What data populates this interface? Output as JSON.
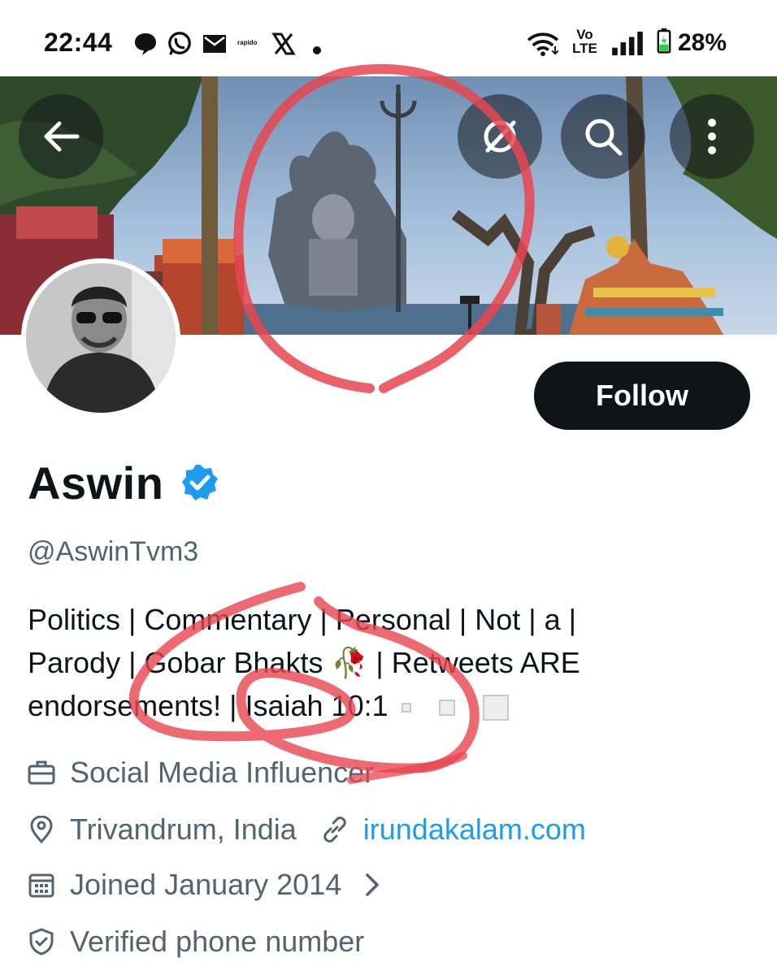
{
  "status_bar": {
    "time": "22:44",
    "icons": [
      "chat-bubble-icon",
      "whatsapp-icon",
      "mail-icon",
      "rapido-icon",
      "x-logo-icon",
      "dot-icon"
    ],
    "rapido_label": "rapido",
    "network_label_top": "Vo",
    "network_label_bottom": "LTE",
    "battery": "28%"
  },
  "banner": {
    "buttons": [
      "back-arrow-icon",
      "grok-icon",
      "search-icon",
      "more-vertical-icon"
    ]
  },
  "profile": {
    "display_name": "Aswin",
    "handle": "@AswinTvm3",
    "follow_label": "Follow",
    "bio_lines": [
      "Politics | Commentary | Personal | Not | a |",
      "Parody | Gobar Bhakts 🥀 | Retweets ARE",
      "endorsements! | Isaiah 10:1"
    ],
    "profession": "Social Media Influencer",
    "location": "Trivandrum, India",
    "website": "irundakalam.com",
    "joined": "Joined January 2014",
    "verified_phone": "Verified phone number"
  },
  "colors": {
    "text_primary": "#0f1419",
    "text_secondary": "#536471",
    "link": "#1d9bf0",
    "verified": "#1d9bf0",
    "annotation": "#e8454f"
  }
}
